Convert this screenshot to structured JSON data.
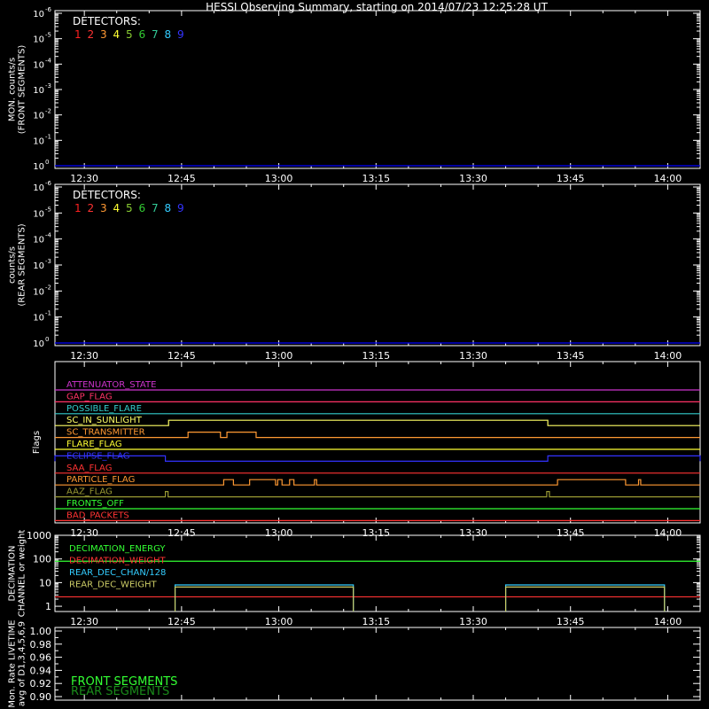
{
  "title": "HESSI Observing Summary, starting on 2014/07/23 12:25:28 UT",
  "time_axis": {
    "start": "12:25:28",
    "end": "14:05:00",
    "ticks": [
      "12:30",
      "12:45",
      "13:00",
      "13:15",
      "13:30",
      "13:45",
      "14:00"
    ]
  },
  "colors": {
    "background": "#000000",
    "axes": "#ffffff",
    "detectors": [
      "#ff2020",
      "#ff3333",
      "#ff9933",
      "#ffff33",
      "#88cc33",
      "#33cc33",
      "#33cc99",
      "#33ccff",
      "#3333ff"
    ]
  },
  "chart_data": [
    {
      "type": "line",
      "panel": "front-counts",
      "ylabel_lines": [
        "MON. counts/s",
        "(FRONT SEGMENTS)"
      ],
      "yscale": "log",
      "ylim_exp": [
        0,
        6
      ],
      "y_tick_labels": [
        {
          "exp": 0,
          "label": "10",
          "sup": "0"
        },
        {
          "exp": 1,
          "label": "10",
          "sup": "-1"
        },
        {
          "exp": 2,
          "label": "10",
          "sup": "-2"
        },
        {
          "exp": 3,
          "label": "10",
          "sup": "-3"
        },
        {
          "exp": 4,
          "label": "10",
          "sup": "-4"
        },
        {
          "exp": 5,
          "label": "10",
          "sup": "-5"
        },
        {
          "exp": 6,
          "label": "10",
          "sup": "-6"
        }
      ],
      "legend_title": "DETECTORS:",
      "legend": [
        "1",
        "2",
        "3",
        "4",
        "5",
        "6",
        "7",
        "8",
        "9"
      ],
      "legend_placement": "top-left",
      "series": [
        {
          "color": "#0000ff",
          "points": [
            [
              "12:25:28",
              0
            ],
            [
              "14:05:00",
              0
            ]
          ]
        }
      ]
    },
    {
      "type": "line",
      "panel": "rear-counts",
      "ylabel_lines": [
        "counts/s",
        "(REAR SEGMENTS)"
      ],
      "yscale": "log",
      "ylim_exp": [
        0,
        6
      ],
      "y_tick_labels": [
        {
          "exp": 0,
          "label": "10",
          "sup": "0"
        },
        {
          "exp": 1,
          "label": "10",
          "sup": "-1"
        },
        {
          "exp": 2,
          "label": "10",
          "sup": "-2"
        },
        {
          "exp": 3,
          "label": "10",
          "sup": "-3"
        },
        {
          "exp": 4,
          "label": "10",
          "sup": "-4"
        },
        {
          "exp": 5,
          "label": "10",
          "sup": "-5"
        },
        {
          "exp": 6,
          "label": "10",
          "sup": "-6"
        }
      ],
      "legend_title": "DETECTORS:",
      "legend": [
        "1",
        "2",
        "3",
        "4",
        "5",
        "6",
        "7",
        "8",
        "9"
      ],
      "legend_placement": "top-left",
      "series": [
        {
          "color": "#0000ff",
          "points": [
            [
              "12:25:28",
              0
            ],
            [
              "14:05:00",
              0
            ]
          ]
        }
      ]
    },
    {
      "type": "line",
      "panel": "flags",
      "ylabel": "Flags",
      "flags": [
        {
          "name": "ATTENUATOR_STATE",
          "color": "#cc33cc",
          "high": []
        },
        {
          "name": "GAP_FLAG",
          "color": "#ff3366",
          "high": []
        },
        {
          "name": "POSSIBLE_FLARE",
          "color": "#33cccc",
          "high": []
        },
        {
          "name": "SC_IN_SUNLIGHT",
          "color": "#ffff66",
          "high": [
            [
              "12:43:00",
              "13:41:30"
            ]
          ]
        },
        {
          "name": "SC_TRANSMITTER",
          "color": "#ff9933",
          "high": [
            [
              "12:46:00",
              "12:51:00"
            ],
            [
              "12:52:00",
              "12:56:30"
            ]
          ]
        },
        {
          "name": "FLARE_FLAG",
          "color": "#ffff33",
          "high": []
        },
        {
          "name": "ECLIPSE_FLAG",
          "color": "#3333ff",
          "high": [
            [
              "12:25:28",
              "12:42:30"
            ],
            [
              "13:41:30",
              "14:05:00"
            ]
          ]
        },
        {
          "name": "SAA_FLAG",
          "color": "#ff3333",
          "high": []
        },
        {
          "name": "PARTICLE_FLAG",
          "color": "#ff9933",
          "high": [
            [
              "12:51:30",
              "12:53:00"
            ],
            [
              "12:55:30",
              "12:59:30"
            ],
            [
              "12:59:50",
              "13:00:30"
            ],
            [
              "13:01:40",
              "13:02:20"
            ],
            [
              "13:05:30",
              "13:05:50"
            ],
            [
              "13:43:00",
              "13:53:30"
            ],
            [
              "13:55:30",
              "13:55:50"
            ]
          ]
        },
        {
          "name": "AAZ_FLAG",
          "color": "#999933",
          "high": [
            [
              "12:42:30",
              "12:42:55"
            ],
            [
              "13:41:20",
              "13:41:45"
            ]
          ]
        },
        {
          "name": "FRONTS_OFF",
          "color": "#33ff33",
          "high": []
        },
        {
          "name": "BAD_PACKETS",
          "color": "#ff3333",
          "high": []
        }
      ]
    },
    {
      "type": "line",
      "panel": "decimation",
      "ylabel_lines": [
        "DECIMATION",
        "CHANNEL or weight"
      ],
      "yscale": "log",
      "ylim": [
        0.6,
        1000
      ],
      "y_tick_labels": [
        "1",
        "10",
        "100",
        "1000"
      ],
      "series": [
        {
          "name": "DECIMATION_ENERGY",
          "color": "#33ff33",
          "segments": [
            [
              [
                "12:25:28",
                80
              ],
              [
                "14:05:00",
                80
              ]
            ]
          ]
        },
        {
          "name": "DECIMATION_WEIGHT",
          "color": "#ff3333",
          "segments": [
            [
              [
                "12:25:28",
                2.5
              ],
              [
                "14:05:00",
                2.5
              ]
            ]
          ]
        },
        {
          "name": "REAR_DEC_CHAN/128",
          "color": "#33ccff",
          "segments": [
            [
              [
                "12:44:00",
                0.6
              ],
              [
                "12:44:00",
                8
              ],
              [
                "13:11:30",
                8
              ],
              [
                "13:11:30",
                0.6
              ]
            ],
            [
              [
                "13:35:00",
                0.6
              ],
              [
                "13:35:00",
                8
              ],
              [
                "13:59:30",
                8
              ],
              [
                "13:59:30",
                0.6
              ]
            ]
          ]
        },
        {
          "name": "REAR_DEC_WEIGHT",
          "color": "#cccc66",
          "segments": [
            [
              [
                "12:44:00",
                0.6
              ],
              [
                "12:44:00",
                6.5
              ],
              [
                "13:11:30",
                6.5
              ],
              [
                "13:11:30",
                0.6
              ]
            ],
            [
              [
                "13:35:00",
                0.6
              ],
              [
                "13:35:00",
                6.5
              ],
              [
                "13:59:30",
                6.5
              ],
              [
                "13:59:30",
                0.6
              ]
            ]
          ]
        }
      ]
    },
    {
      "type": "line",
      "panel": "livetime",
      "ylabel_lines": [
        "Mon. Rate LIVETIME",
        "avg of D1,3,4,5,6,9"
      ],
      "ylim": [
        0.9,
        1.0
      ],
      "y_tick_labels": [
        "0.90",
        "0.92",
        "0.94",
        "0.96",
        "0.98",
        "1.00"
      ],
      "legend": [
        {
          "name": "FRONT SEGMENTS",
          "color": "#33ff33"
        },
        {
          "name": "REAR SEGMENTS",
          "color": "#1a8c1a"
        }
      ],
      "series": []
    }
  ]
}
